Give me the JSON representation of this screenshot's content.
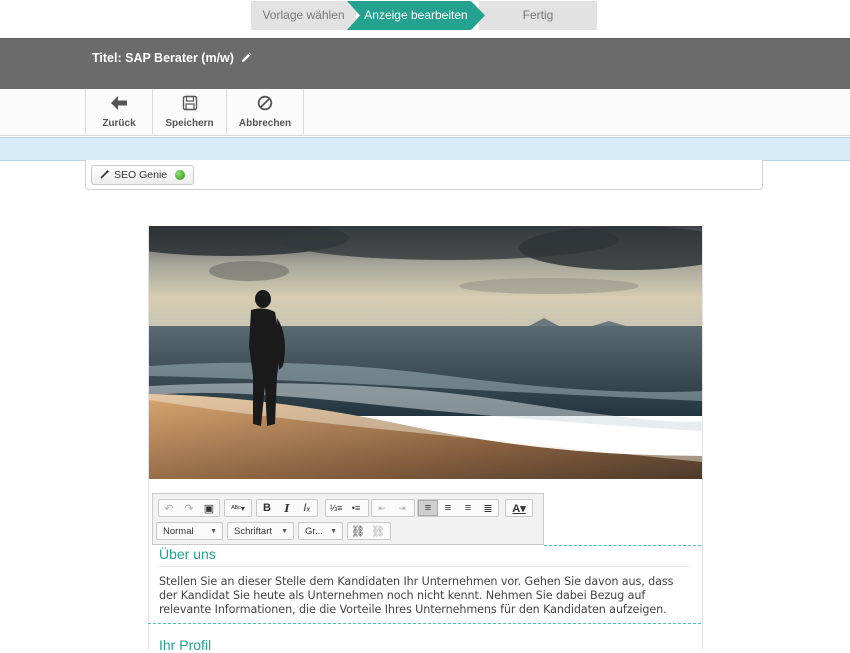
{
  "wizard": {
    "steps": [
      {
        "label": "Vorlage wählen",
        "state": "done"
      },
      {
        "label": "Anzeige bearbeiten",
        "state": "active"
      },
      {
        "label": "Fertig",
        "state": "pending"
      }
    ]
  },
  "header": {
    "title": "Titel: SAP Berater (m/w)",
    "edit_icon": "pencil-icon"
  },
  "toolbar": {
    "back_label": "Zurück",
    "save_label": "Speichern",
    "cancel_label": "Abbrechen"
  },
  "seo": {
    "button_label": "SEO Genie",
    "status_color": "#3a9a20"
  },
  "editor": {
    "format_label": "Normal",
    "font_label": "Schriftart",
    "size_label": "Gr..."
  },
  "content": {
    "section1_title": "Über uns",
    "section1_text": "Stellen Sie an dieser Stelle dem Kandidaten Ihr Unternehmen vor. Gehen Sie davon aus, dass der Kandidat Sie heute als Unternehmen noch nicht kennt. Nehmen Sie dabei Bezug auf relevante Informationen, die die Vorteile Ihres Unternehmens für den Kandidaten aufzeigen.",
    "section2_title": "Ihr Profil"
  },
  "colors": {
    "accent": "#23a28f",
    "titlebar": "#6b6b6b",
    "infobar": "#d6ebf7"
  }
}
